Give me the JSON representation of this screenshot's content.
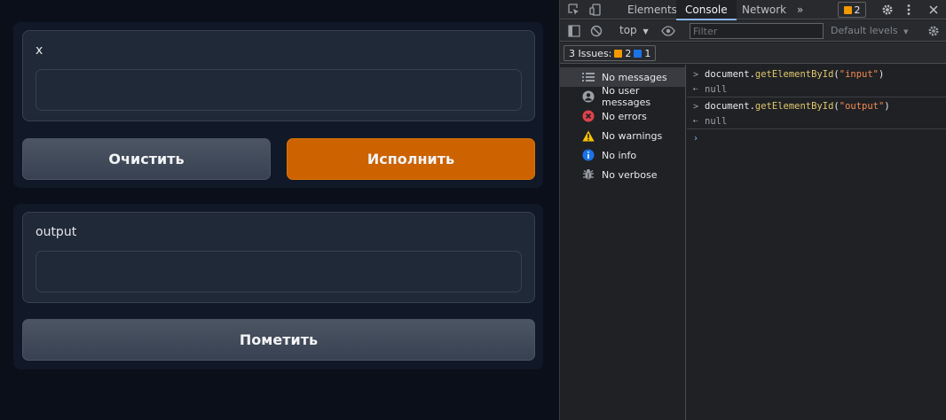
{
  "app": {
    "input_label": "x",
    "input_value": "",
    "clear_button": "Очистить",
    "submit_button": "Исполнить",
    "output_label": "output",
    "output_value": "",
    "flag_button": "Пометить"
  },
  "devtools": {
    "tabs": [
      "Elements",
      "Console",
      "Network"
    ],
    "more_tabs": "»",
    "issues_badge_count": "2",
    "context": "top",
    "filter_placeholder": "Filter",
    "default_levels": "Default levels",
    "issues_label": "3 Issues:",
    "issues_warning_count": "2",
    "issues_info_count": "1",
    "sidebar": [
      {
        "label": "No messages",
        "icon": "list-icon"
      },
      {
        "label": "No user messages",
        "icon": "user-icon"
      },
      {
        "label": "No errors",
        "icon": "error-icon"
      },
      {
        "label": "No warnings",
        "icon": "warning-icon"
      },
      {
        "label": "No info",
        "icon": "info-icon"
      },
      {
        "label": "No verbose",
        "icon": "bug-icon"
      }
    ],
    "console": [
      {
        "prefix": "document.",
        "fn": "getElementById",
        "open": "(",
        "arg": "\"input\"",
        "close": ")",
        "result": "null"
      },
      {
        "prefix": "document.",
        "fn": "getElementById",
        "open": "(",
        "arg": "\"output\"",
        "close": ")",
        "result": "null"
      }
    ],
    "colors": {
      "accent": "#cc6200",
      "tab_underline": "#8ab4f8",
      "warning": "#f29900",
      "error": "#e0424b",
      "info": "#1a73e8"
    }
  }
}
